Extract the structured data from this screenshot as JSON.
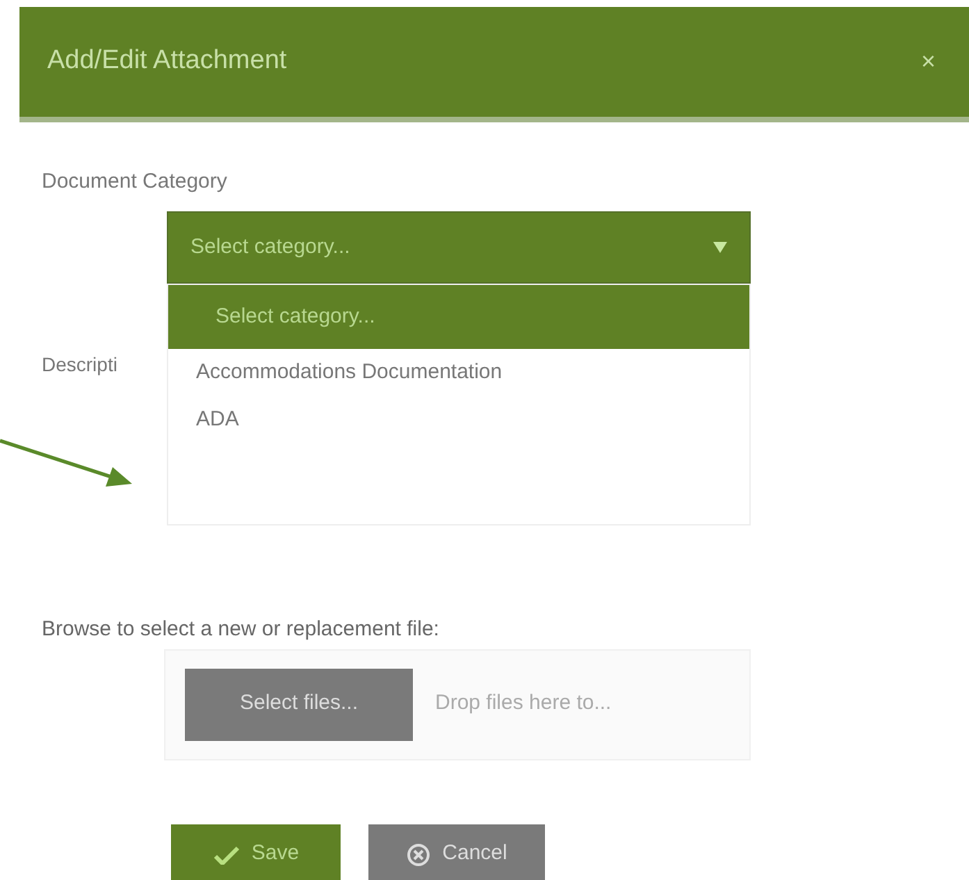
{
  "dialog": {
    "title": "Add/Edit Attachment",
    "close": "×"
  },
  "category": {
    "label": "Document Category",
    "value": "Select category...",
    "options": [
      {
        "label": "Select category...",
        "selected": true
      },
      {
        "label": "Accommodations Documentation",
        "selected": false
      },
      {
        "label": "ADA",
        "selected": false
      }
    ]
  },
  "description": {
    "label": "Descripti"
  },
  "upload": {
    "label": "Browse to select a new or replacement file:",
    "button": "Select files...",
    "hint": "Drop files here to..."
  },
  "buttons": [
    {
      "kind": "save",
      "label": "Save"
    },
    {
      "kind": "cancel",
      "label": "Cancel"
    }
  ]
}
